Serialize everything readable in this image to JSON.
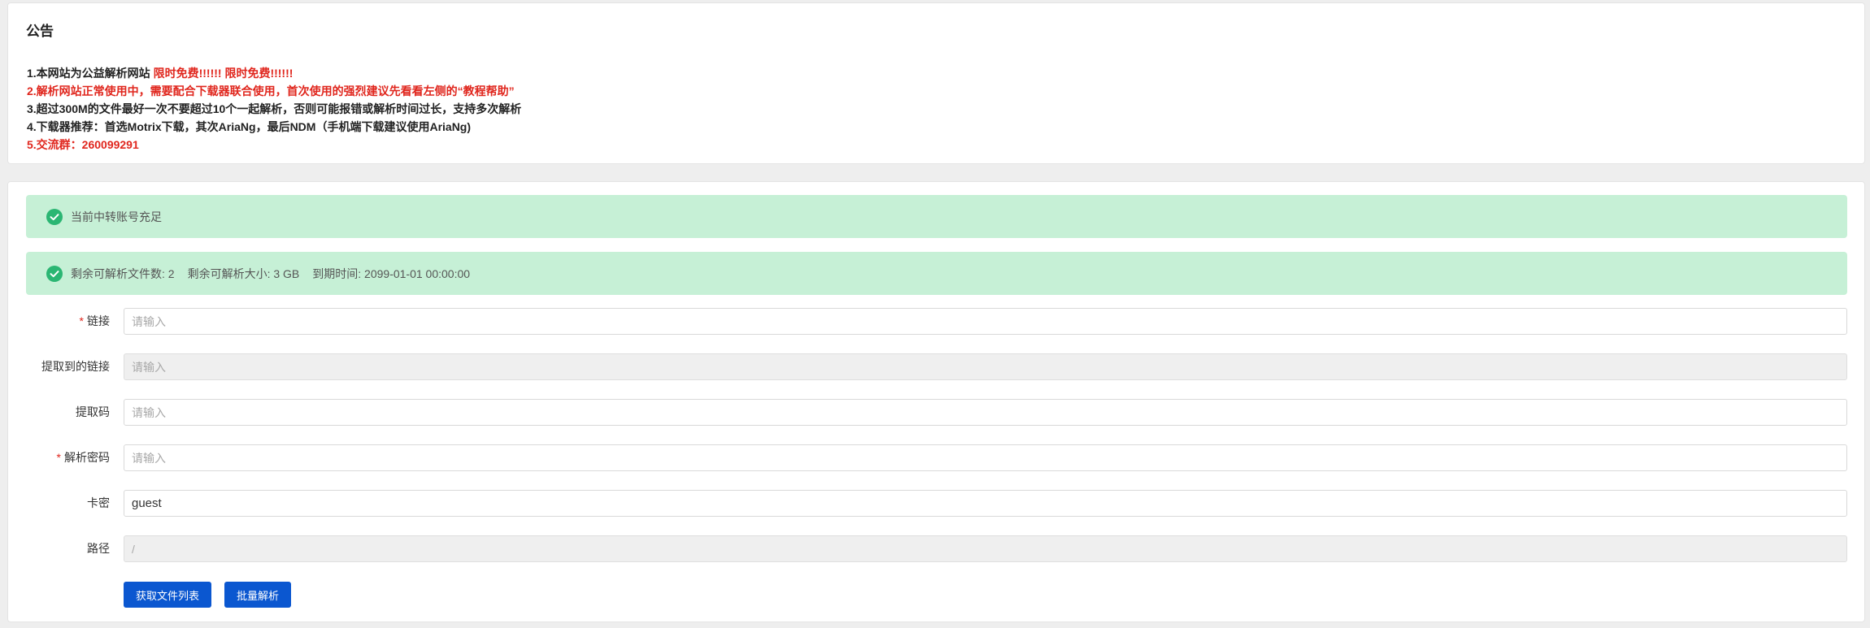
{
  "colors": {
    "accent_red": "#e0261d",
    "success_bg": "#c6f0d6",
    "success_icon": "#2bb673",
    "primary_button": "#0b57d0"
  },
  "notice": {
    "title": "公告",
    "line1_prefix": "1.本网站为公益解析网站 ",
    "line1_highlight": "限时免费!!!!!! 限时免费!!!!!!",
    "line2": "2.解析网站正常使用中，需要配合下载器联合使用，首次使用的强烈建议先看看左侧的“教程帮助”",
    "line3": "3.超过300M的文件最好一次不要超过10个一起解析，否则可能报错或解析时间过长，支持多次解析",
    "line4": "4.下载器推荐：首选Motrix下载，其次AriaNg，最后NDM（手机端下载建议使用AriaNg)",
    "line5": "5.交流群：260099291"
  },
  "alerts": {
    "status": {
      "icon": "check-circle-icon",
      "text": "当前中转账号充足"
    },
    "quota": {
      "icon": "check-circle-icon",
      "files": "剩余可解析文件数: 2",
      "size": "剩余可解析大小: 3 GB",
      "expire": "到期时间: 2099-01-01 00:00:00"
    }
  },
  "form": {
    "link": {
      "label": "链接",
      "required": "*",
      "value": "",
      "placeholder": "请输入"
    },
    "extracted": {
      "label": "提取到的链接",
      "value": "",
      "placeholder": "请输入"
    },
    "code": {
      "label": "提取码",
      "value": "",
      "placeholder": "请输入"
    },
    "password": {
      "label": "解析密码",
      "required": "*",
      "value": "",
      "placeholder": "请输入"
    },
    "card_key": {
      "label": "卡密",
      "value": "guest",
      "placeholder": ""
    },
    "path": {
      "label": "路径",
      "value": "/",
      "placeholder": ""
    }
  },
  "buttons": {
    "get_file_list": "获取文件列表",
    "batch_parse": "批量解析"
  }
}
